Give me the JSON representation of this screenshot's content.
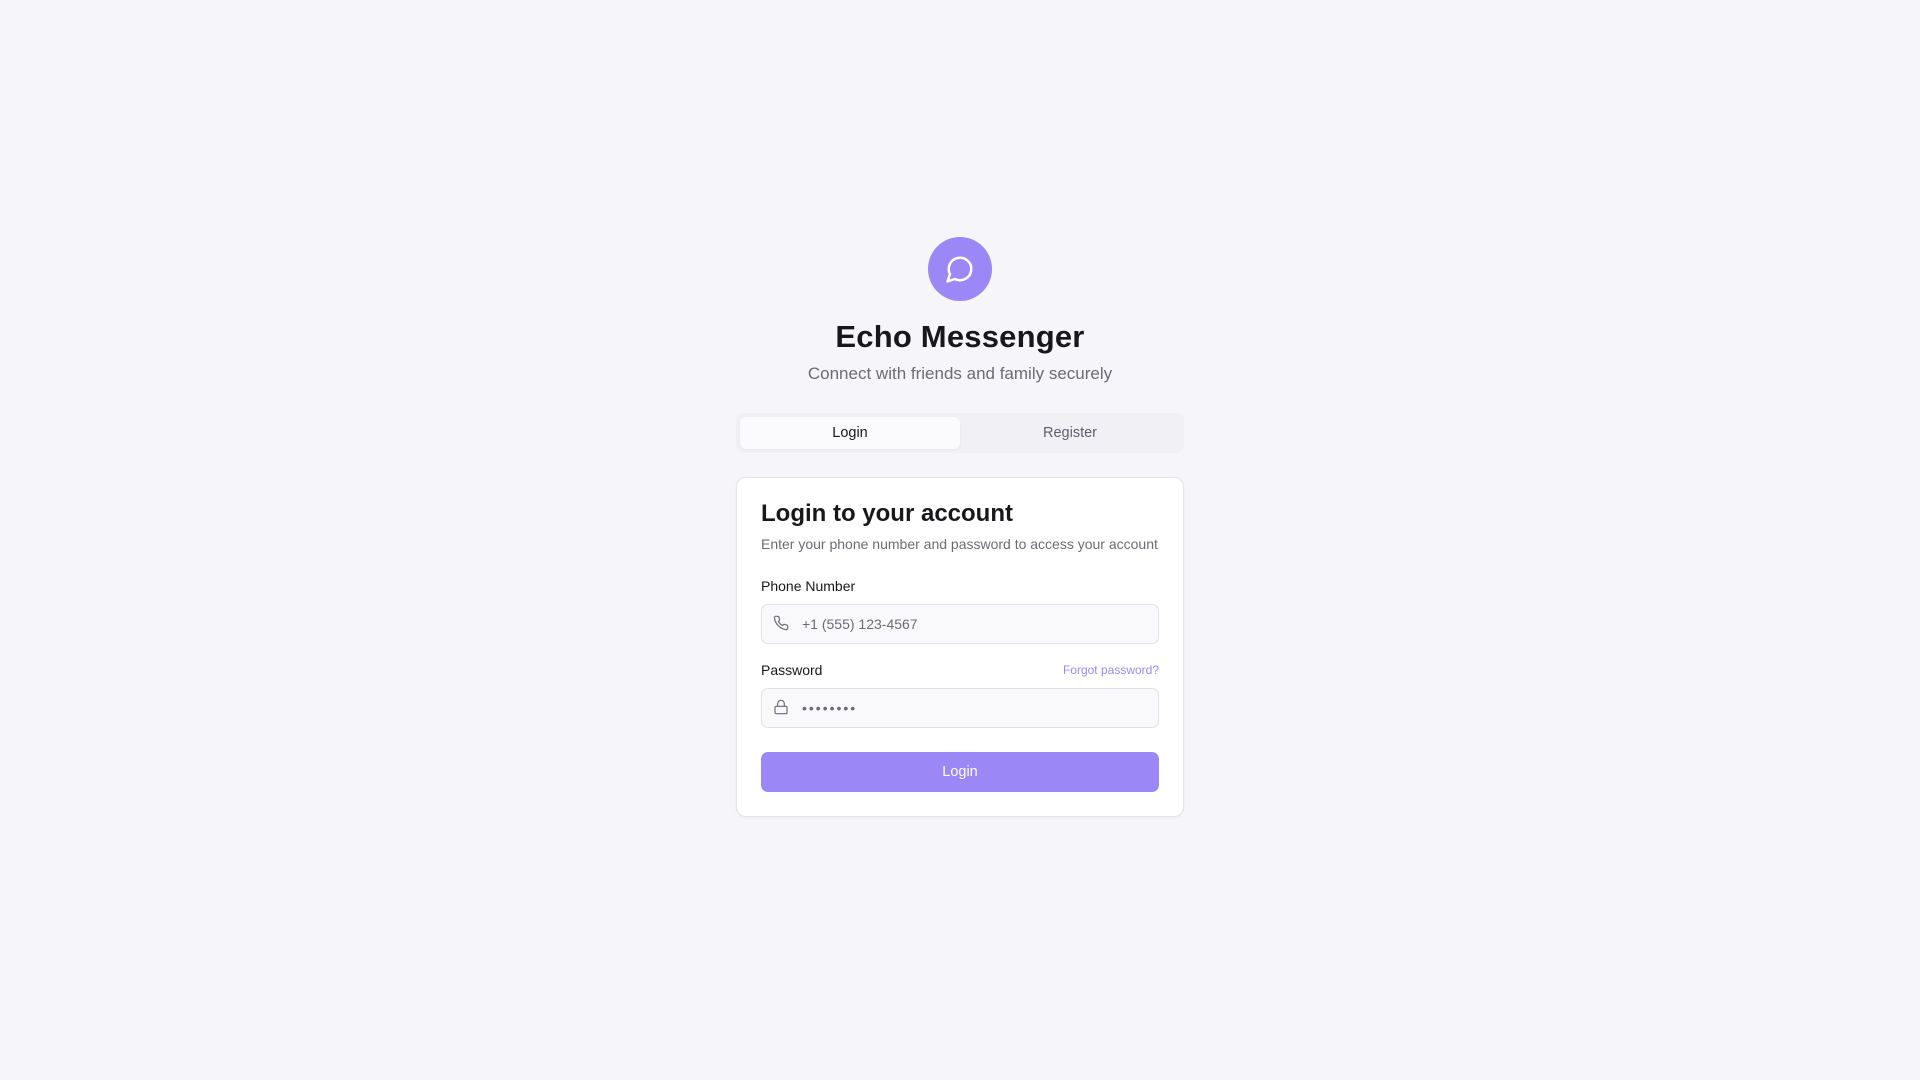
{
  "app": {
    "title": "Echo Messenger",
    "subtitle": "Connect with friends and family securely",
    "logo_icon": "message-circle-icon",
    "accent_color": "#9b87f5"
  },
  "tabs": [
    {
      "label": "Login",
      "active": true
    },
    {
      "label": "Register",
      "active": false
    }
  ],
  "card": {
    "title": "Login to your account",
    "description": "Enter your phone number and password to access your account"
  },
  "form": {
    "phone": {
      "label": "Phone Number",
      "placeholder": "+1 (555) 123-4567",
      "value": "",
      "icon": "phone-icon"
    },
    "password": {
      "label": "Password",
      "placeholder": "••••••••",
      "value": "",
      "icon": "lock-icon",
      "forgot_label": "Forgot password?"
    },
    "submit_label": "Login"
  }
}
